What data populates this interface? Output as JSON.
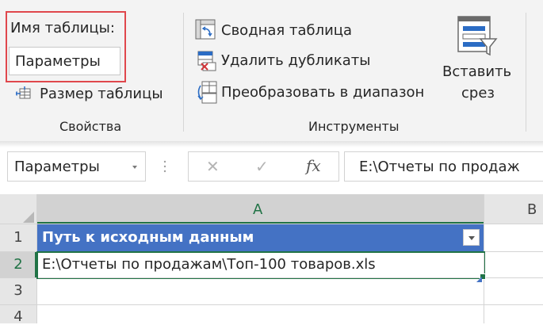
{
  "ribbon": {
    "properties": {
      "table_name_label": "Имя таблицы:",
      "table_name_value": "Параметры",
      "resize_table_label": "Размер таблицы",
      "group_label": "Свойства"
    },
    "tools": {
      "pivot_label": "Сводная таблица",
      "remove_duplicates_label": "Удалить дубликаты",
      "convert_to_range_label": "Преобразовать в диапазон",
      "group_label": "Инструменты"
    },
    "insert_slicer": {
      "line1": "Вставить",
      "line2": "срез"
    }
  },
  "formula_bar": {
    "name_box_value": "Параметры",
    "cancel_glyph": "✕",
    "enter_glyph": "✓",
    "fx_label": "fx",
    "formula_value": "E:\\Отчеты по продаж"
  },
  "grid": {
    "columns": [
      "A",
      "B"
    ],
    "rows": [
      "1",
      "2",
      "3",
      "4"
    ],
    "header_cell": "Путь к исходным данным",
    "data_cell": "E:\\Отчеты по продажам\\Топ-100 товаров.xls"
  },
  "colors": {
    "highlight_border": "#e0474c",
    "table_header_fill": "#4472c4",
    "selection_green": "#217346"
  }
}
